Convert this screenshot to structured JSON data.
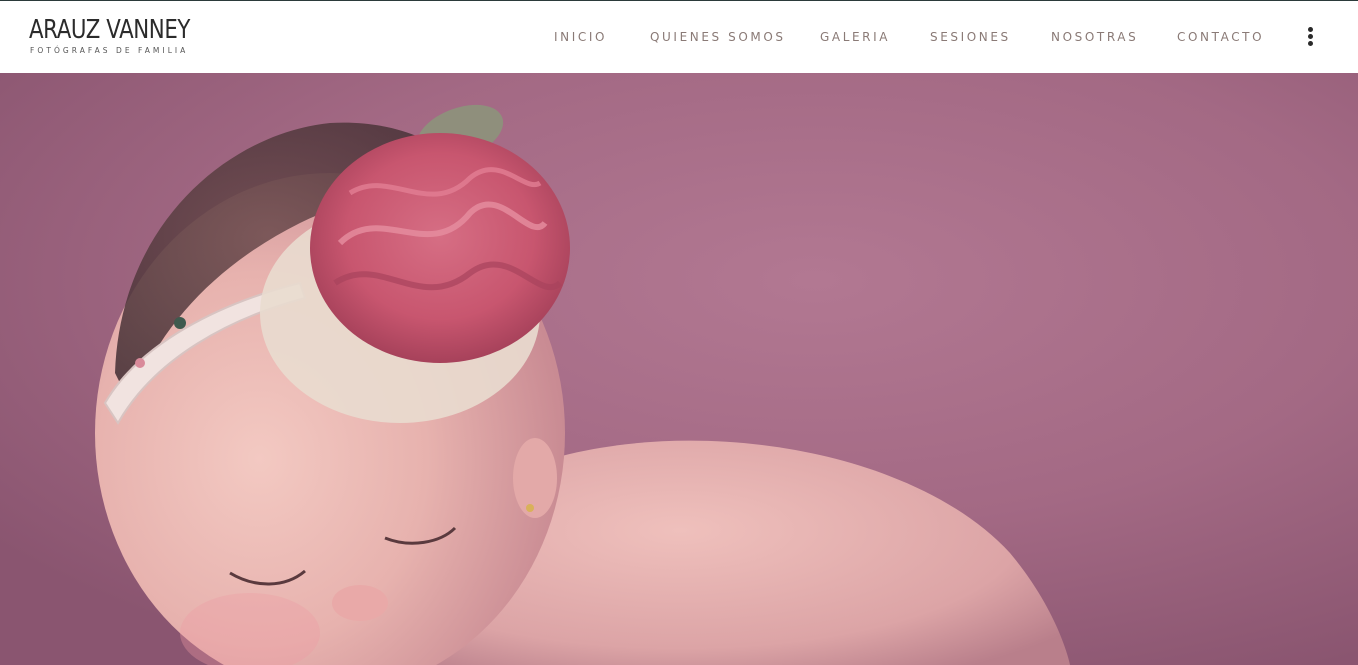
{
  "brand": {
    "name": "ARAUZ VANNEY",
    "tagline": "FOTÓGRAFAS DE FAMILIA"
  },
  "nav": {
    "items": [
      {
        "label": "INICIO"
      },
      {
        "label": "QUIENES SOMOS"
      },
      {
        "label": "GALERIA"
      },
      {
        "label": "SESIONES"
      },
      {
        "label": "NOSOTRAS"
      },
      {
        "label": "CONTACTO"
      }
    ],
    "more_icon": "kebab-menu-icon"
  },
  "colors": {
    "nav_text": "#8a7a76",
    "hero_background": "#a56b86",
    "flower": "#c8566f"
  }
}
